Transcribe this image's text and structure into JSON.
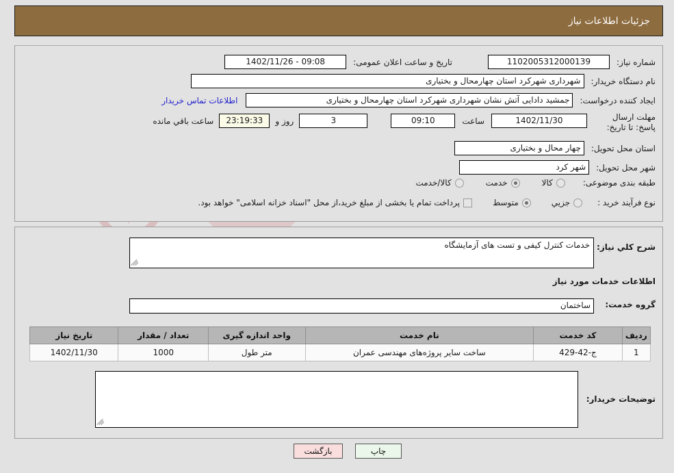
{
  "header": {
    "title": "جزئیات اطلاعات نیاز"
  },
  "top_section": {
    "need_number": {
      "label": "شماره نیاز:",
      "value": "1102005312000139"
    },
    "public_announce": {
      "label": "تاریخ و ساعت اعلان عمومی:",
      "value": "09:08 - 1402/11/26"
    },
    "buyer_org": {
      "label": "نام دستگاه خریدار:",
      "value": "شهرداری شهرکرد استان چهارمحال و بختیاری"
    },
    "requester": {
      "label": "ایجاد کننده درخواست:",
      "value": "جمشید دادایی آتش نشان شهرداری شهرکرد استان چهارمحال و بختیاری"
    },
    "contact_link": "اطلاعات تماس خریدار",
    "deadline": {
      "label": "مهلت ارسال پاسخ: تا تاریخ:",
      "date": "1402/11/30",
      "time_label": "ساعت",
      "time": "09:10",
      "days": "3",
      "days_label": "روز و",
      "countdown": "23:19:33",
      "countdown_label": "ساعت باقي مانده"
    },
    "delivery_province": {
      "label": "استان محل تحویل:",
      "value": "چهار محال و بختیاری"
    },
    "delivery_city": {
      "label": "شهر محل تحویل:",
      "value": "شهر کرد"
    },
    "category": {
      "label": "طبقه بندی موضوعی:",
      "options": [
        {
          "label": "کالا",
          "selected": false
        },
        {
          "label": "خدمت",
          "selected": true
        },
        {
          "label": "کالا/خدمت",
          "selected": false
        }
      ]
    },
    "purchase_type": {
      "label": "نوع فرآیند خرید :",
      "options": [
        {
          "label": "جزیي",
          "selected": false
        },
        {
          "label": "متوسط",
          "selected": true
        }
      ],
      "checkbox_label": "پرداخت تمام یا بخشی از مبلغ خرید،از محل \"اسناد خزانه اسلامی\" خواهد بود.",
      "checkbox_checked": false
    }
  },
  "mid_section": {
    "general_desc": {
      "label": "شرح کلي نیاز:",
      "value": "خدمات کنترل کیفی و تست های آزمایشگاه"
    },
    "services_heading": "اطلاعات خدمات مورد نیاز",
    "service_group": {
      "label": "گروه خدمت:",
      "value": "ساختمان"
    },
    "table": {
      "columns": [
        "ردیف",
        "کد خدمت",
        "نام خدمت",
        "واحد اندازه گیری",
        "تعداد / مقدار",
        "تاریخ نیاز"
      ],
      "rows": [
        {
          "index": "1",
          "code": "ج-42-429",
          "name": "ساخت سایر پروژه‌های مهندسی عمران",
          "unit": "متر طول",
          "quantity": "1000",
          "need_date": "1402/11/30"
        }
      ]
    },
    "buyer_notes": {
      "label": "توضیحات خریدار:",
      "value": ""
    }
  },
  "footer": {
    "print_label": "چاپ",
    "back_label": "بازگشت"
  },
  "watermark": {
    "text": "AriaTender.net"
  },
  "colors": {
    "header_brown": "#8d6c3f",
    "page_bg": "#e2e2e2",
    "table_header_gray": "#b6b6b6",
    "link_blue": "#2222cc",
    "countdown_cream": "#fbfbe8",
    "print_btn_green": "#eaf7ea",
    "back_btn_pink": "#fadede"
  }
}
